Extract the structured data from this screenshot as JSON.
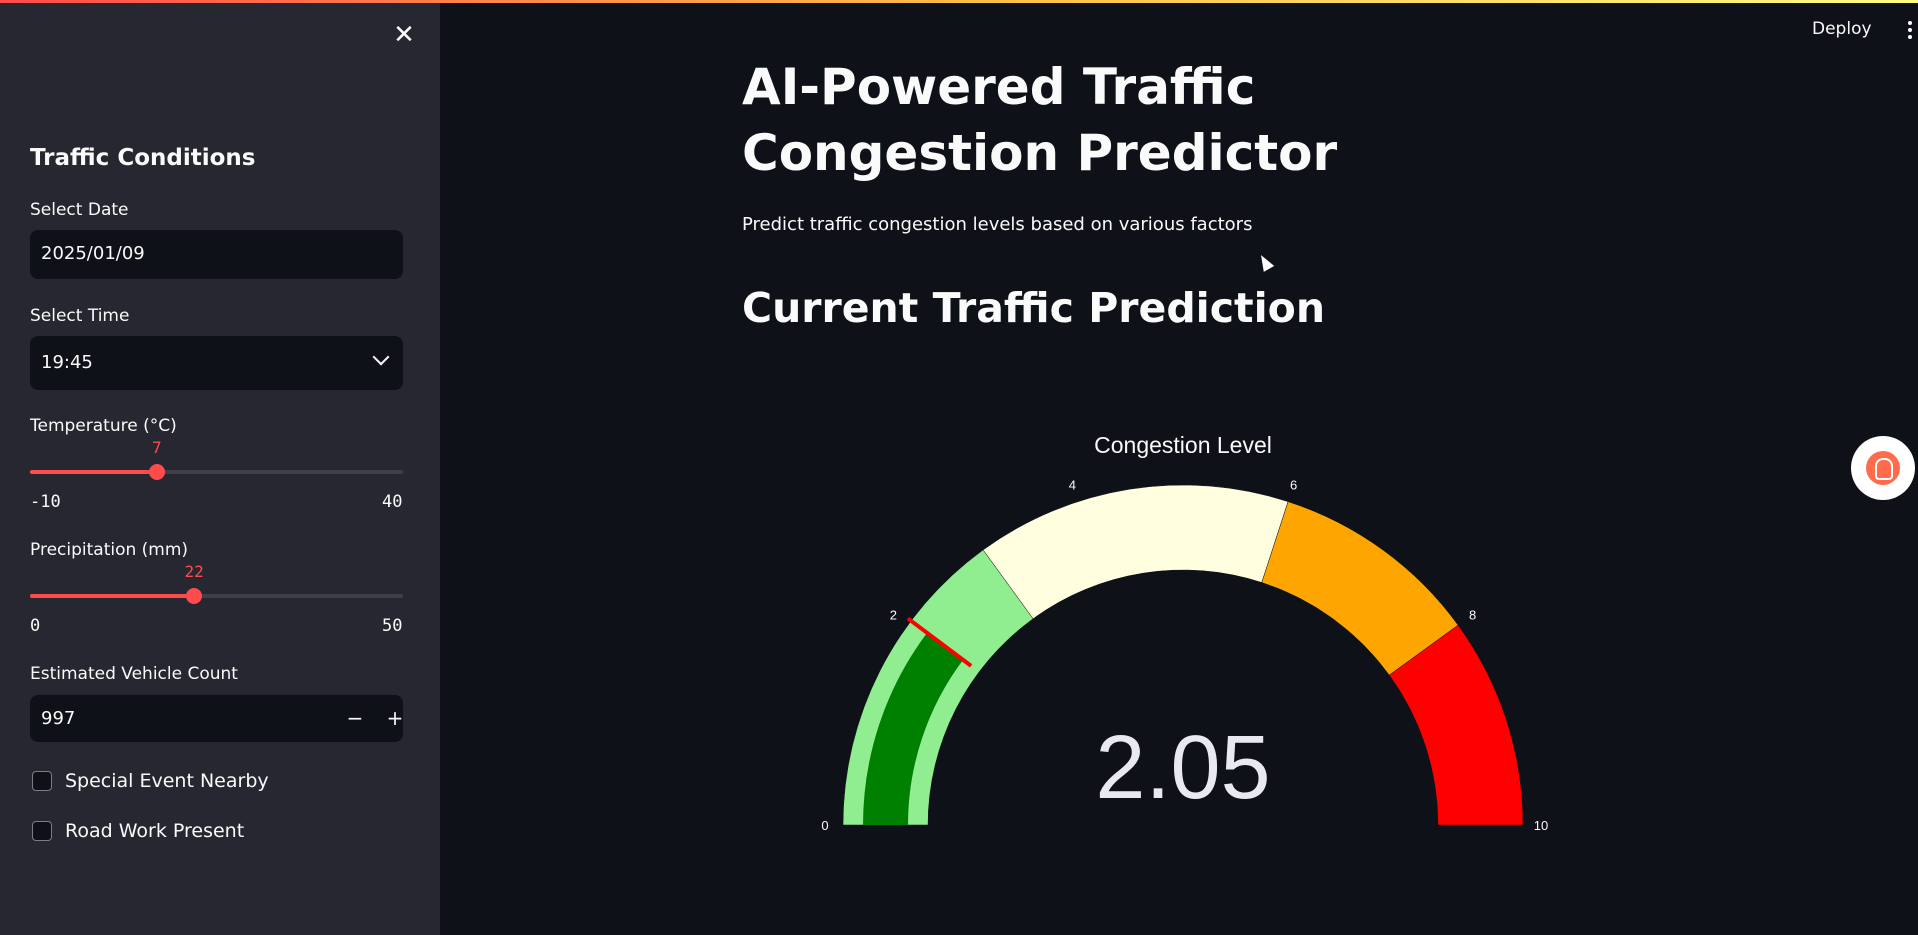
{
  "sidebar": {
    "title": "Traffic Conditions",
    "date": {
      "label": "Select Date",
      "value": "2025/01/09"
    },
    "time": {
      "label": "Select Time",
      "value": "19:45"
    },
    "temperature": {
      "label": "Temperature (°C)",
      "value": "7",
      "min": "-10",
      "max": "40",
      "fraction": 0.34
    },
    "precipitation": {
      "label": "Precipitation (mm)",
      "value": "22",
      "min": "0",
      "max": "50",
      "fraction": 0.44
    },
    "vehicles": {
      "label": "Estimated Vehicle Count",
      "value": "997",
      "minus": "−",
      "plus": "+"
    },
    "checkboxes": [
      {
        "label": "Special Event Nearby",
        "checked": false
      },
      {
        "label": "Road Work Present",
        "checked": false
      }
    ]
  },
  "header": {
    "deploy": "Deploy"
  },
  "main": {
    "title": "AI-Powered Traffic Congestion Predictor",
    "subtitle": "Predict traffic congestion levels based on various factors",
    "section": "Current Traffic Prediction"
  },
  "chart_data": {
    "type": "gauge",
    "title": "Congestion Level",
    "value": 2.05,
    "value_label": "2.05",
    "range": [
      0,
      10
    ],
    "ticks": [
      "0",
      "2",
      "4",
      "6",
      "8",
      "10"
    ],
    "steps": [
      {
        "range": [
          0,
          3
        ],
        "color": "#90ee90"
      },
      {
        "range": [
          3,
          6
        ],
        "color": "#ffffe0"
      },
      {
        "range": [
          6,
          8
        ],
        "color": "#ffa500"
      },
      {
        "range": [
          8,
          10
        ],
        "color": "#ff0000"
      }
    ],
    "bar_color": "#008000",
    "threshold": {
      "value": 2.05,
      "color": "#ff0000"
    }
  },
  "colors": {
    "accent": "#ff4b4b",
    "sidebar_bg": "#262730",
    "main_bg": "#0e1117"
  }
}
